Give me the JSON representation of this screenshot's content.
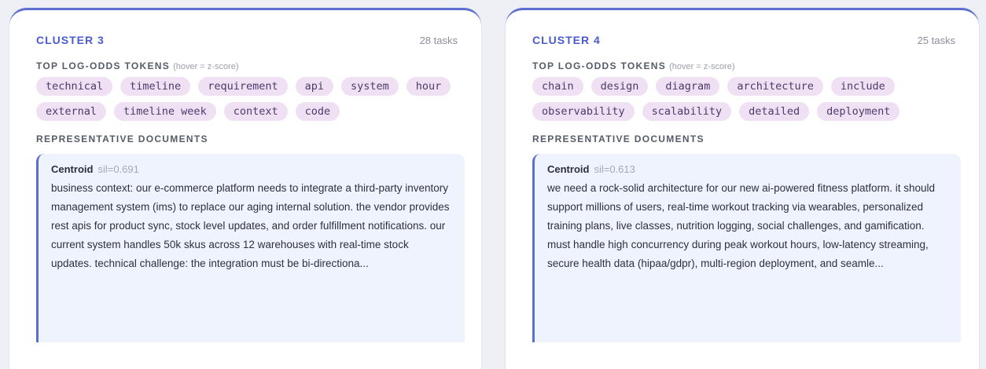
{
  "clusters": [
    {
      "title": "CLUSTER 3",
      "count": "28 tasks",
      "tokens_label": "TOP LOG-ODDS TOKENS",
      "tokens_hint": "(hover = z-score)",
      "tokens": [
        "technical",
        "timeline",
        "requirement",
        "api",
        "system",
        "hour",
        "external",
        "timeline week",
        "context",
        "code"
      ],
      "rep_label": "REPRESENTATIVE DOCUMENTS",
      "doc": {
        "label": "Centroid",
        "sil": "sil=0.691",
        "text": "business context: our e-commerce platform needs to integrate a third-party inventory management system (ims) to replace our aging internal solution. the vendor provides rest apis for product sync, stock level updates, and order fulfillment notifications. our current system handles 50k skus across 12 warehouses with real-time stock updates. technical challenge: the integration must be bi-directiona..."
      }
    },
    {
      "title": "CLUSTER 4",
      "count": "25 tasks",
      "tokens_label": "TOP LOG-ODDS TOKENS",
      "tokens_hint": "(hover = z-score)",
      "tokens": [
        "chain",
        "design",
        "diagram",
        "architecture",
        "include",
        "observability",
        "scalability",
        "detailed",
        "deployment"
      ],
      "rep_label": "REPRESENTATIVE DOCUMENTS",
      "doc": {
        "label": "Centroid",
        "sil": "sil=0.613",
        "text": "we need a rock-solid architecture for our new ai-powered fitness platform. it should support millions of users, real-time workout tracking via wearables, personalized training plans, live classes, nutrition logging, social challenges, and gamification. must handle high concurrency during peak workout hours, low-latency streaming, secure health data (hipaa/gdpr), multi-region deployment, and seamle..."
      }
    }
  ],
  "colors": {
    "accent": "#5b6ed1",
    "token_bg": "#f0e0f3",
    "doc_bg": "#eef3fd"
  }
}
